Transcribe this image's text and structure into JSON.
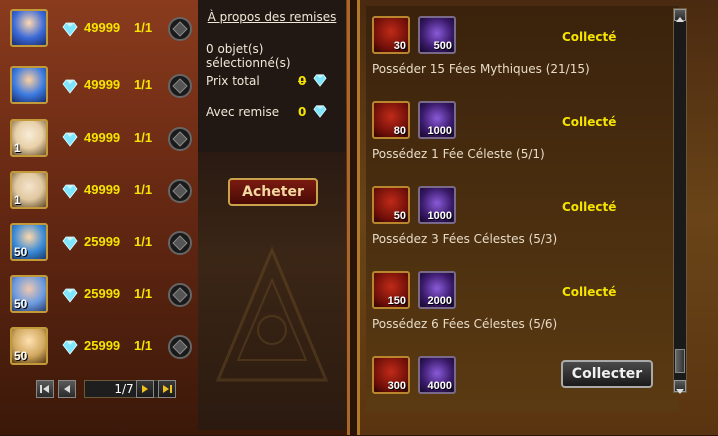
{
  "items": [
    {
      "price": "49999",
      "qty": "1/1",
      "stars": "",
      "portrait_color": "#3a6ad8",
      "icon": "hero-portrait-icon"
    },
    {
      "price": "49999",
      "qty": "1/1",
      "stars": "",
      "portrait_color": "#3a7ae0",
      "icon": "hero-portrait-icon"
    },
    {
      "price": "49999",
      "qty": "1/1",
      "stars": "1",
      "portrait_color": "#e8d0a8",
      "icon": "fairy-portrait-icon"
    },
    {
      "price": "49999",
      "qty": "1/1",
      "stars": "1",
      "portrait_color": "#e0c8a0",
      "icon": "fairy-portrait-icon"
    },
    {
      "price": "25999",
      "qty": "1/1",
      "stars": "50",
      "portrait_color": "#3a8ad8",
      "icon": "hero-portrait-icon"
    },
    {
      "price": "25999",
      "qty": "1/1",
      "stars": "50",
      "portrait_color": "#6a9ae0",
      "icon": "hero-portrait-icon"
    },
    {
      "price": "25999",
      "qty": "1/1",
      "stars": "50",
      "portrait_color": "#d0a860",
      "icon": "hero-portrait-icon"
    }
  ],
  "pager": {
    "page": "1/7"
  },
  "info": {
    "title": "À propos des remises",
    "selected": "0 objet(s) sélectionné(s)",
    "total_label": "Prix total",
    "total_value": "0",
    "discount_label": "Avec remise",
    "discount_value": "0",
    "buy_label": "Acheter"
  },
  "rewards": [
    {
      "chest": "30",
      "gems": "500",
      "status": "Collecté",
      "desc": "Posséder 15 Fées Mythiques (21/15)"
    },
    {
      "chest": "80",
      "gems": "1000",
      "status": "Collecté",
      "desc": "Possédez 1 Fée Céleste (5/1)"
    },
    {
      "chest": "50",
      "gems": "1000",
      "status": "Collecté",
      "desc": "Possédez 3 Fées Célestes (5/3)"
    },
    {
      "chest": "150",
      "gems": "2000",
      "status": "Collecté",
      "desc": "Possédez 6 Fées Célestes (5/6)"
    },
    {
      "chest": "300",
      "gems": "4000",
      "button": "Collecter"
    }
  ],
  "colors": {
    "accent": "#f5e400",
    "diamond": "#7fe6ff"
  }
}
